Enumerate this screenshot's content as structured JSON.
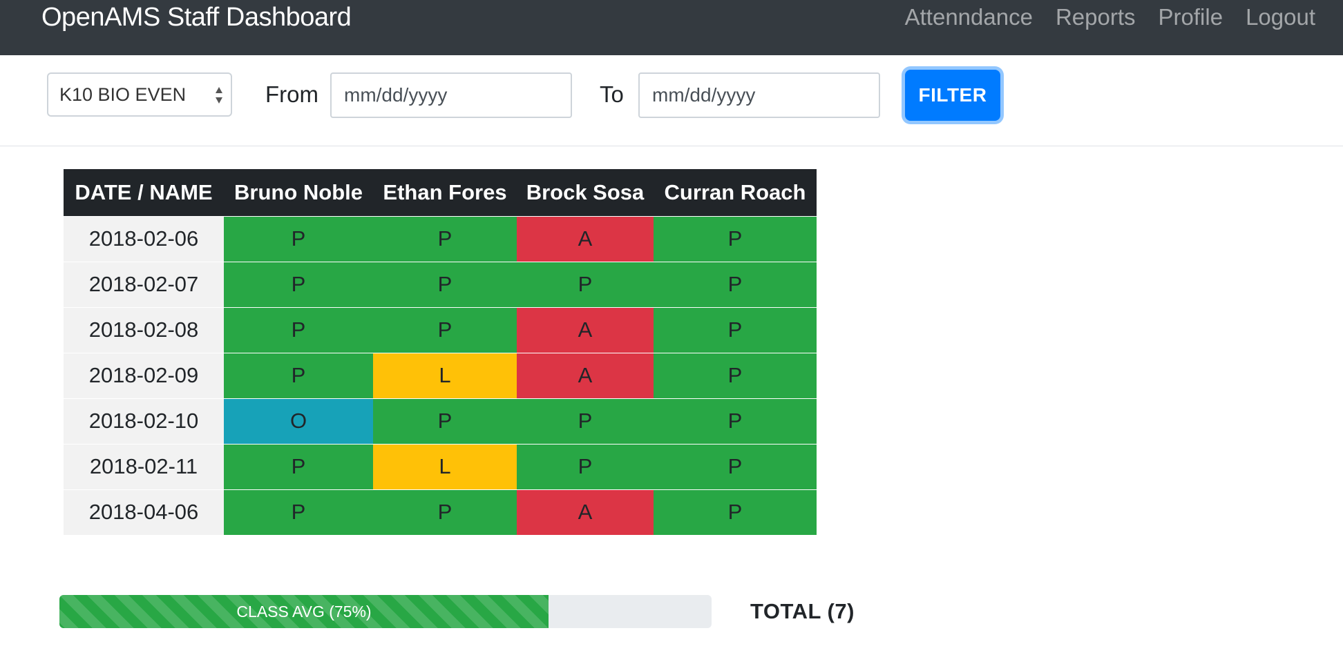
{
  "navbar": {
    "brand": "OpenAMS Staff Dashboard",
    "links": [
      "Attenndance",
      "Reports",
      "Profile",
      "Logout"
    ]
  },
  "filter": {
    "class_select": "K10 BIO EVEN",
    "from_label": "From",
    "from_placeholder": "mm/dd/yyyy",
    "to_label": "To",
    "to_placeholder": "mm/dd/yyyy",
    "button_label": "FILTER"
  },
  "table": {
    "corner_header": "DATE / NAME",
    "students": [
      "Bruno Noble",
      "Ethan Fores",
      "Brock Sosa",
      "Curran Roach"
    ],
    "rows": [
      {
        "date": "2018-02-06",
        "statuses": [
          "P",
          "P",
          "A",
          "P"
        ]
      },
      {
        "date": "2018-02-07",
        "statuses": [
          "P",
          "P",
          "P",
          "P"
        ]
      },
      {
        "date": "2018-02-08",
        "statuses": [
          "P",
          "P",
          "A",
          "P"
        ]
      },
      {
        "date": "2018-02-09",
        "statuses": [
          "P",
          "L",
          "A",
          "P"
        ]
      },
      {
        "date": "2018-02-10",
        "statuses": [
          "O",
          "P",
          "P",
          "P"
        ]
      },
      {
        "date": "2018-02-11",
        "statuses": [
          "P",
          "L",
          "P",
          "P"
        ]
      },
      {
        "date": "2018-04-06",
        "statuses": [
          "P",
          "P",
          "A",
          "P"
        ]
      }
    ]
  },
  "status_colors": {
    "P": "#28a745",
    "A": "#dc3545",
    "L": "#ffc107",
    "O": "#17a2b8"
  },
  "summary": {
    "class_avg_label": "CLASS AVG (75%)",
    "class_avg_percent": 75,
    "total_label": "TOTAL (7)"
  }
}
